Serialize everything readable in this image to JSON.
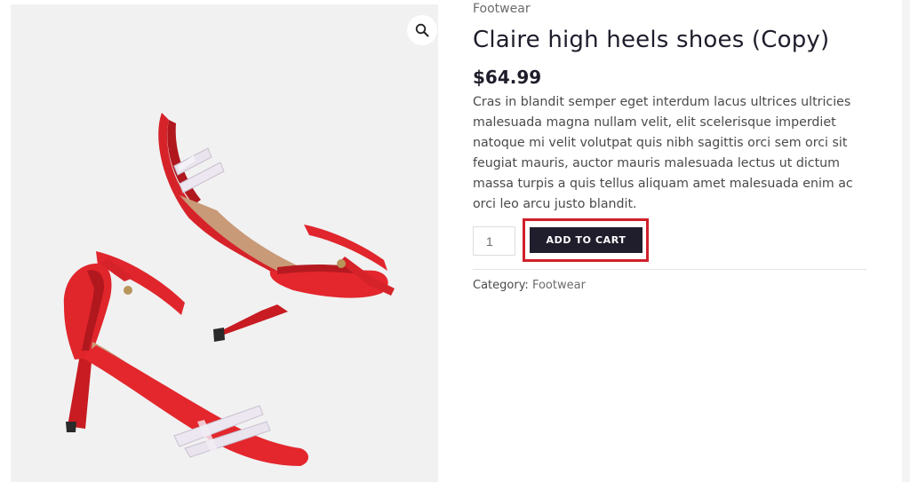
{
  "gallery": {
    "image_alt": "Red high heel sandals",
    "zoom_icon": "magnifier-icon"
  },
  "product": {
    "category_label": "Footwear",
    "title": "Claire high heels shoes (Copy)",
    "price": "$64.99",
    "description_lines": [
      "Cras in blandit semper eget interdum lacus ultrices ultricies",
      "malesuada magna nullam velit, elit scelerisque imperdiet",
      "natoque mi velit volutpat quis nibh sagittis orci sem orci sit",
      "feugiat mauris, auctor mauris malesuada lectus ut dictum",
      "massa turpis a quis tellus aliquam amet malesuada enim ac",
      "orci leo arcu justo blandit."
    ]
  },
  "cart": {
    "quantity": "1",
    "add_to_cart_label": "ADD TO CART"
  },
  "meta": {
    "category_prefix": "Category: ",
    "category_link": "Footwear"
  },
  "colors": {
    "accent_button": "#201e2c",
    "highlight_border": "#d0202a",
    "shoe_red": "#e0252b"
  }
}
